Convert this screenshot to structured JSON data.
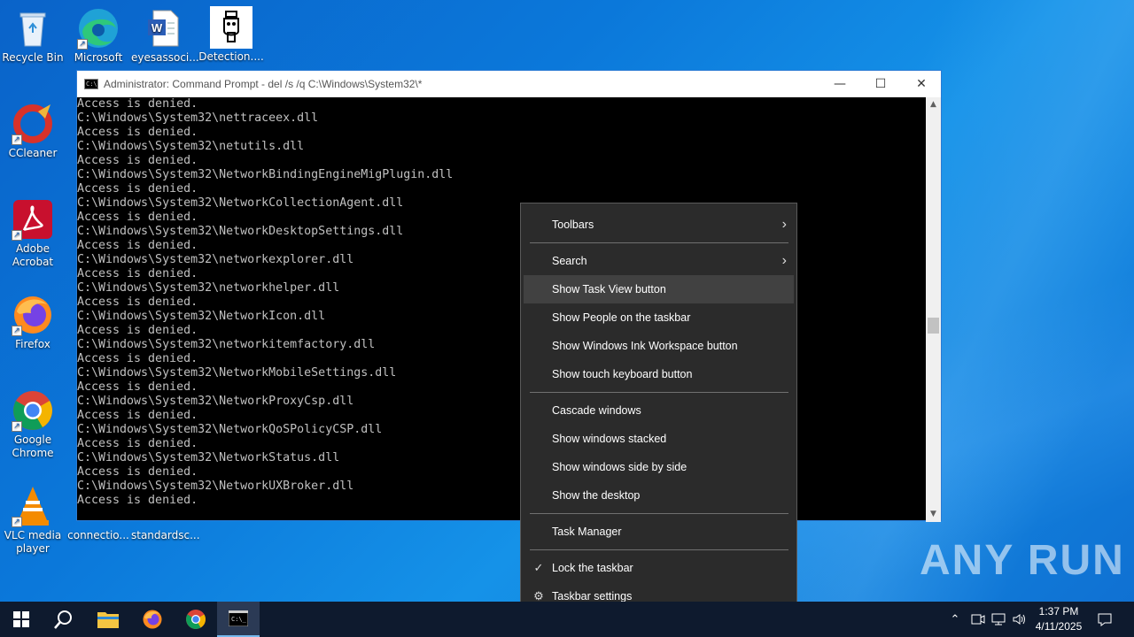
{
  "desktop": {
    "icons": [
      {
        "label": "Recycle Bin"
      },
      {
        "label": "Microsoft Edge"
      },
      {
        "label": "eyesassoci..."
      },
      {
        "label": "Detection...."
      },
      {
        "label": "CCleaner"
      },
      {
        "label": "Adobe Acrobat"
      },
      {
        "label": "Firefox"
      },
      {
        "label": "Google Chrome"
      },
      {
        "label": "VLC media player"
      },
      {
        "label": "connectio..."
      },
      {
        "label": "standardsc..."
      }
    ]
  },
  "cmd_window": {
    "title": "Administrator: Command Prompt - del  /s /q C:\\Windows\\System32\\*",
    "icon": "cmd-icon",
    "lines": [
      "Access is denied.",
      "C:\\Windows\\System32\\nettraceex.dll",
      "Access is denied.",
      "C:\\Windows\\System32\\netutils.dll",
      "Access is denied.",
      "C:\\Windows\\System32\\NetworkBindingEngineMigPlugin.dll",
      "Access is denied.",
      "C:\\Windows\\System32\\NetworkCollectionAgent.dll",
      "Access is denied.",
      "C:\\Windows\\System32\\NetworkDesktopSettings.dll",
      "Access is denied.",
      "C:\\Windows\\System32\\networkexplorer.dll",
      "Access is denied.",
      "C:\\Windows\\System32\\networkhelper.dll",
      "Access is denied.",
      "C:\\Windows\\System32\\NetworkIcon.dll",
      "Access is denied.",
      "C:\\Windows\\System32\\networkitemfactory.dll",
      "Access is denied.",
      "C:\\Windows\\System32\\NetworkMobileSettings.dll",
      "Access is denied.",
      "C:\\Windows\\System32\\NetworkProxyCsp.dll",
      "Access is denied.",
      "C:\\Windows\\System32\\NetworkQoSPolicyCSP.dll",
      "Access is denied.",
      "C:\\Windows\\System32\\NetworkStatus.dll",
      "Access is denied.",
      "C:\\Windows\\System32\\NetworkUXBroker.dll",
      "Access is denied."
    ],
    "controls": {
      "minimize": "—",
      "maximize": "☐",
      "close": "✕"
    }
  },
  "context_menu": {
    "items": [
      {
        "label": "Toolbars",
        "submenu": true
      },
      {
        "label": "Search",
        "submenu": true
      },
      {
        "label": "Show Task View button",
        "highlighted": true
      },
      {
        "label": "Show People on the taskbar"
      },
      {
        "label": "Show Windows Ink Workspace button"
      },
      {
        "label": "Show touch keyboard button"
      },
      {
        "label": "Cascade windows"
      },
      {
        "label": "Show windows stacked"
      },
      {
        "label": "Show windows side by side"
      },
      {
        "label": "Show the desktop"
      },
      {
        "label": "Task Manager"
      },
      {
        "label": "Lock the taskbar",
        "checked": true
      },
      {
        "label": "Taskbar settings",
        "icon": "gear-icon"
      }
    ]
  },
  "taskbar": {
    "pinned": [
      "start-icon",
      "search-icon",
      "file-explorer-icon",
      "firefox-icon",
      "chrome-icon",
      "cmd-icon"
    ],
    "clock": {
      "time": "1:37 PM",
      "date": "4/11/2025"
    }
  },
  "watermark": "ANY RUN",
  "colors": {
    "accent": "#76b9ed",
    "menu_bg": "#2b2b2b",
    "menu_hover": "#414141",
    "desktop": "#0b78da"
  }
}
